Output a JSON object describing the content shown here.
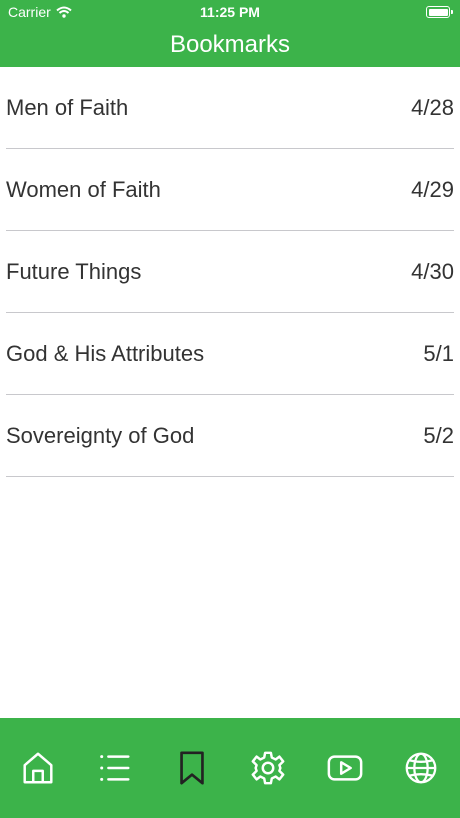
{
  "status_bar": {
    "carrier": "Carrier",
    "time": "11:25 PM"
  },
  "header": {
    "title": "Bookmarks"
  },
  "bookmarks": [
    {
      "name": "Men of Faith",
      "date": "4/28"
    },
    {
      "name": "Women of Faith",
      "date": "4/29"
    },
    {
      "name": "Future Things",
      "date": "4/30"
    },
    {
      "name": "God & His Attributes",
      "date": "5/1"
    },
    {
      "name": "Sovereignty of God",
      "date": "5/2"
    }
  ],
  "tabbar": {
    "tabs": [
      {
        "icon": "home-icon"
      },
      {
        "icon": "list-icon"
      },
      {
        "icon": "bookmark-icon",
        "selected": true
      },
      {
        "icon": "gear-icon"
      },
      {
        "icon": "youtube-play-icon"
      },
      {
        "icon": "globe-icon"
      }
    ]
  },
  "colors": {
    "accent": "#3cb34a",
    "icon_default": "#ffffff",
    "icon_selected": "#222222"
  }
}
